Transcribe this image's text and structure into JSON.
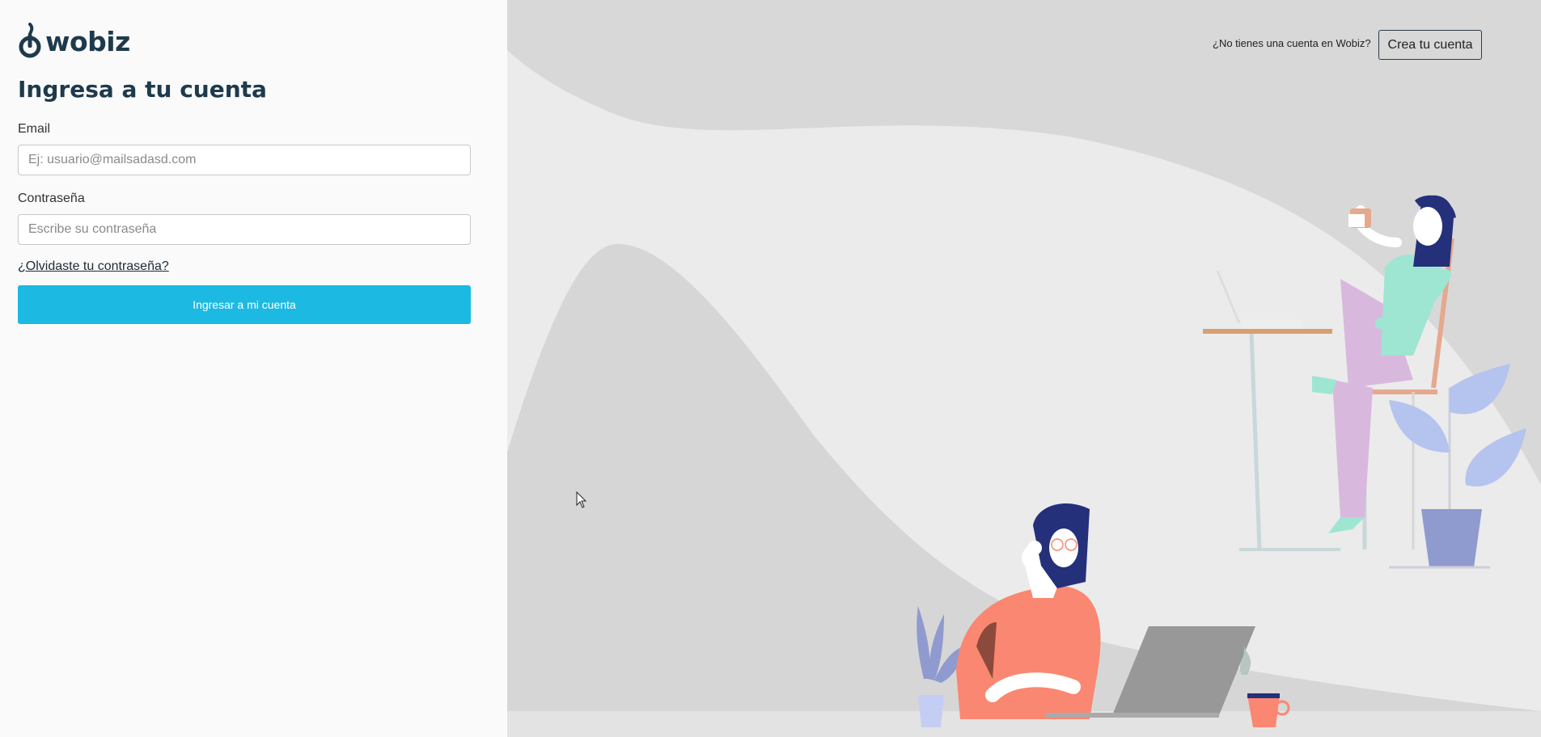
{
  "brand": {
    "name": "wobiz",
    "color": "#1e3a4c"
  },
  "login": {
    "title": "Ingresa a tu cuenta",
    "email_label": "Email",
    "email_placeholder": "Ej: usuario@mailsadasd.com",
    "email_value": "",
    "password_label": "Contraseña",
    "password_placeholder": "Escribe su contraseña",
    "password_value": "",
    "forgot_link": "¿Olvidaste tu contraseña?",
    "submit_label": "Ingresar a mi cuenta"
  },
  "signup": {
    "prompt": "¿No tienes una cuenta en Wobiz?",
    "button_label": "Crea tu cuenta"
  },
  "colors": {
    "accent": "#1cb9e3",
    "panel_background": "#ebebeb",
    "left_background": "#fafafa"
  },
  "icons": [
    "wobiz-logo-icon",
    "mouse-cursor-icon"
  ]
}
